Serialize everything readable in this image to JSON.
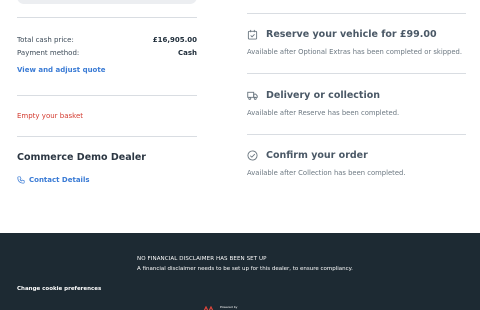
{
  "basket": {
    "rows": [
      {
        "label": "Total cash price:",
        "value": "£16,905.00"
      },
      {
        "label": "Payment method:",
        "value": "Cash"
      }
    ],
    "quote_link": "View and adjust quote",
    "empty_basket": "Empty your basket",
    "dealer_name": "Commerce Demo Dealer",
    "contact_link": "Contact Details"
  },
  "steps": [
    {
      "icon": "calendar-check-icon",
      "title": "Reserve your vehicle for £99.00",
      "desc": "Available after Optional Extras has been completed or skipped."
    },
    {
      "icon": "delivery-truck-icon",
      "title": "Delivery or collection",
      "desc": "Available after Reserve has been completed."
    },
    {
      "icon": "check-circle-icon",
      "title": "Confirm your order",
      "desc": "Available after Collection has been completed."
    }
  ],
  "footer": {
    "disclaimer_title": "NO FINANCIAL DISCLAIMER HAS BEEN SET UP",
    "disclaimer_text": "A financial disclaimer needs to be set up for this dealer, to ensure compliancy.",
    "cookie_link": "Change cookie preferences",
    "powered_by": "Powered by"
  },
  "colors": {
    "accent": "#3a7bd5",
    "danger": "#d33a2f",
    "footer_bg": "#1d2a33"
  }
}
